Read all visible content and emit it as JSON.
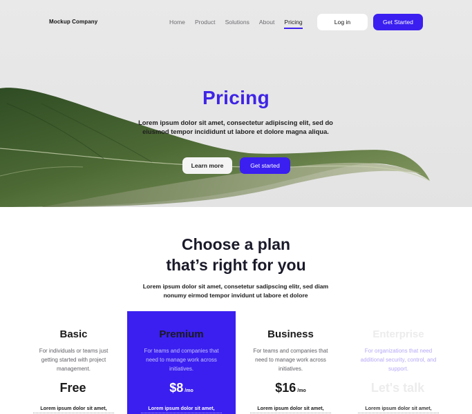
{
  "nav": {
    "brand": "Mockup Company",
    "links": [
      {
        "label": "Home"
      },
      {
        "label": "Product"
      },
      {
        "label": "Solutions"
      },
      {
        "label": "About"
      },
      {
        "label": "Pricing"
      }
    ],
    "active": "Pricing",
    "login_label": "Log in",
    "cta_label": "Get Started"
  },
  "hero": {
    "title": "Pricing",
    "subtitle": "Lorem ipsum dolor sit amet, consectetur adipiscing elit, sed do eiusmod tempor incididunt ut labore et dolore magna aliqua.",
    "learn_more_label": "Learn more",
    "get_started_label": "Get started"
  },
  "plans_section": {
    "title_line1": "Choose a plan",
    "title_line2": "that’s right for you",
    "subtitle": "Lorem ipsum dolor sit amet, consetetur sadipscing elitr, sed diam nonumy eirmod tempor invidunt ut labore et dolore"
  },
  "plans": [
    {
      "name": "Basic",
      "description": "For individuals or teams just getting started with project management.",
      "price": "Free",
      "per": "",
      "feature": "Lorem ipsum dolor sit amet,"
    },
    {
      "name": "Premium",
      "description": "For teams and companies that need to manage work across initiatives.",
      "price": "$8",
      "per": "/mo",
      "feature": "Lorem ipsum dolor sit amet,"
    },
    {
      "name": "Business",
      "description": "For teams and companies that need to manage work across initiatives.",
      "price": "$16",
      "per": "/mo",
      "feature": "Lorem ipsum dolor sit amet,"
    },
    {
      "name": "Enterprise",
      "description": "For organizations that need additional security, control, and support.",
      "price": "Let's talk",
      "per": "",
      "feature": "Lorem ipsum dolor sit amet,"
    }
  ],
  "colors": {
    "accent": "#3a1ff0",
    "title_accent": "#3e24e6",
    "hero_bg": "#e6e6e6"
  }
}
